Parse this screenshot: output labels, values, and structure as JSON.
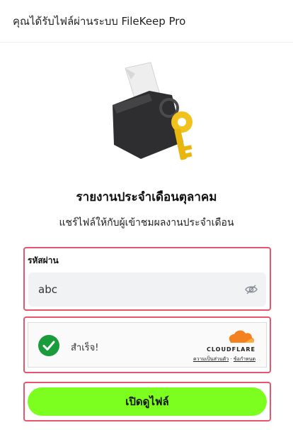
{
  "header": {
    "title": "คุณได้รับไฟล์ผ่านระบบ FileKeep Pro"
  },
  "illustration": {
    "icon": "folder-key-icon"
  },
  "document": {
    "title": "รายงานประจำเดือนตุลาคม",
    "subtitle": "แชร์ไฟล์ให้กับผู้เข้าชมผลงานประจำเดือน"
  },
  "password": {
    "label": "รหัสผ่าน",
    "value": "abc",
    "toggle_icon": "eye-off-icon"
  },
  "captcha": {
    "status_text": "สำเร็จ!",
    "brand": "CLOUDFLARE",
    "privacy_link": "ความเป็นส่วนตัว",
    "separator": "·",
    "terms_link": "ข้อกำหนด",
    "check_color": "#1a9b3c",
    "brand_color": "#f48120"
  },
  "actions": {
    "open_label": "เปิดดูไฟล์",
    "accent": "#7cff1f"
  },
  "highlight_color": "#e8556d"
}
